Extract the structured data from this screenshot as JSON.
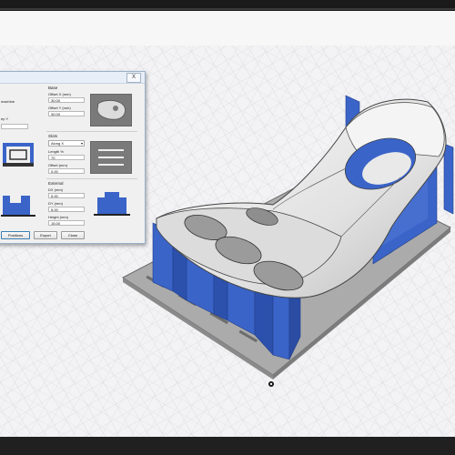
{
  "dialog": {
    "close_label": "X",
    "left_texts": {
      "machine": "machine",
      "step": "ep Y"
    },
    "base": {
      "title": "Base",
      "offset_x_label": "Offset X (mm)",
      "offset_x_value": "30.00",
      "offset_y_label": "Offset Y (mm)",
      "offset_y_value": "30.00"
    },
    "slots": {
      "title": "Slots",
      "along_value": "Along X",
      "length_label": "Length %",
      "length_value": "70",
      "offset_label": "Offset (mm)",
      "offset_value": "0.00"
    },
    "external": {
      "title": "External",
      "dx_label": "DX (mm)",
      "dx_value": "5.00",
      "dy_label": "DY (mm)",
      "dy_value": "5.00",
      "height_label": "Height (mm)",
      "height_value": "15.00"
    },
    "buttons": {
      "positions": "Positions",
      "export": "Export",
      "close": "Close"
    }
  },
  "colors": {
    "accent_blue": "#3a64c8",
    "plate_gray": "#a9a9a9",
    "panel_gray": "#7a7a7a",
    "part_white": "#ececec"
  }
}
